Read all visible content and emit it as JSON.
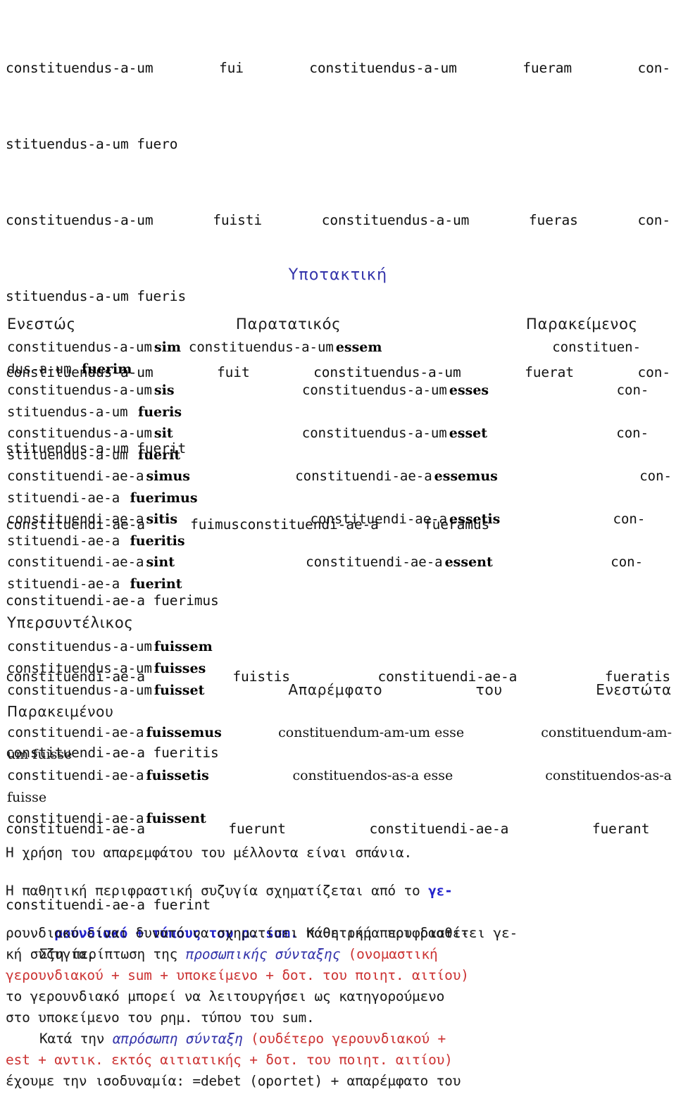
{
  "document": {
    "language": "Greek / Latin grammar reference",
    "indicative_block": {
      "lines": [
        {
          "left_stem": "constituendus-a-um",
          "left_form": "fui",
          "mid_stem": "constituendus-a-um",
          "mid_form": "fueram",
          "tail": "con-"
        },
        {
          "cont": "stituendus-a-um fuero"
        },
        {
          "left_stem": "constituendus-a-um",
          "left_form": "fuisti",
          "mid_stem": "constituendus-a-um",
          "mid_form": "fueras",
          "tail": "con-"
        },
        {
          "cont": "stituendus-a-um fueris"
        },
        {
          "left_stem": "constituendus-a-um",
          "left_form": "fuit",
          "mid_stem": "constituendus-a-um",
          "mid_form": "fuerat",
          "tail": "con-"
        },
        {
          "cont": "stituendus-a-um fuerit"
        },
        {
          "left_stem": "constituendi-ae-a",
          "left_form": "fuimus",
          "mid_stem": "constituendi-ae-a",
          "mid_form": "fueramus",
          "tail": ""
        },
        {
          "cont": "constituendi-ae-a fuerimus"
        },
        {
          "left_stem": "constituendi-ae-a",
          "left_form": "fuistis",
          "mid_stem": "constituendi-ae-a",
          "mid_form": "fueratis",
          "tail": ""
        },
        {
          "cont": "constituendi-ae-a fueritis"
        },
        {
          "left_stem": "constituendi-ae-a",
          "left_form": "fuerunt",
          "mid_stem": "constituendi-ae-a",
          "mid_form": "fuerant",
          "tail": ""
        },
        {
          "cont": "constituendi-ae-a fuerint"
        }
      ]
    },
    "subjunctive": {
      "heading": "Υποτακτική",
      "columns": [
        "Ενεστώς",
        "Παρατατικός",
        "Παρακείμενος"
      ],
      "rows": [
        {
          "c1_stem": "constituendus-a-um",
          "c1_end": "sim",
          "c2_stem": "constituendus-a-um",
          "c2_end": "essem",
          "c3_tail": "constituen-",
          "wrap": "dus-a-um ",
          "wrap_end": "fuerim"
        },
        {
          "c1_stem": "constituendus-a-um",
          "c1_end": "sis",
          "c2_stem": "constituendus-a-um",
          "c2_end": "esses",
          "c3_tail": "con-",
          "wrap": "stituendus-a-um ",
          "wrap_end": "fueris"
        },
        {
          "c1_stem": "constituendus-a-um",
          "c1_end": "sit",
          "c2_stem": "constituendus-a-um",
          "c2_end": "esset",
          "c3_tail": "con-",
          "wrap": "stituendus-a-um ",
          "wrap_end": "fuerit"
        },
        {
          "c1_stem": "constituendi-ae-a",
          "c1_end": "simus",
          "c2_stem": "constituendi-ae-a",
          "c2_end": "essemus",
          "c3_tail": "con-",
          "wrap": "stituendi-ae-a ",
          "wrap_end": "fuerimus"
        },
        {
          "c1_stem": "constituendi-ae-a",
          "c1_end": "sitis",
          "c2_stem": "constituendi-ae-a",
          "c2_end": "essetis",
          "c3_tail": "con-",
          "wrap": "stituendi-ae-a ",
          "wrap_end": "fueritis"
        },
        {
          "c1_stem": "constituendi-ae-a",
          "c1_end": "sint",
          "c2_stem": "constituendi-ae-a",
          "c2_end": "essent",
          "c3_tail": "con-",
          "wrap": "stituendi-ae-a ",
          "wrap_end": "fuerint"
        }
      ]
    },
    "pluperfect": {
      "heading": "Υπερσυντέλικος",
      "rows": [
        {
          "stem": "constituendus-a-um",
          "end": "fuissem"
        },
        {
          "stem": "constituendus-a-um",
          "end": "fuisses"
        },
        {
          "stem": "constituendus-a-um",
          "end": "fuisset",
          "greek1": "Απαρέμφατο",
          "greek2": "του",
          "greek3": "Ενεστώτα"
        },
        {
          "greek_wrap": "Παρακειμένου"
        },
        {
          "stem": "constituendi-ae-a",
          "end": "fuissemus",
          "inf1": "constituendum-am-um esse",
          "inf2": "constituendum-am-"
        },
        {
          "inf_wrap": "um fuisse"
        },
        {
          "stem": "constituendi-ae-a",
          "end": "fuissetis",
          "inf1": "constituendos-as-a esse",
          "inf2": "constituendos-as-a"
        },
        {
          "inf_wrap": "fuisse"
        },
        {
          "stem": "constituendi-ae-a",
          "end": "fuissent"
        }
      ]
    },
    "prose": {
      "note_future_infinitive": "Η χρήση του απαρεμφάτου του μέλλοντα είναι σπάνια.",
      "para_periphrastic": {
        "seg1": "Η παθητική περιφραστική συζυγία σχηματίζεται από το ",
        "seg2_blue_start": "γε-",
        "line2_blue": "ρουνδιακό + τύπους του ρ. sum.",
        "line2_rest": " Κάθε ρήμα που διαθέτει γε-",
        "line3": "ρουνδιακό είναι δυνατό να σχηματίσει παθητική περιφραστι-",
        "line4": "κή συζυγία."
      },
      "para_personal": {
        "lead": "Στη περίπτωση της ",
        "blue_italic": "προσωπικής σύνταξης",
        "red_open": " (ονομαστική",
        "red_line2": "γερουνδιακού + sum + υποκείμενο + δοτ. του ποιητ. αιτίου)",
        "line3": "το γερουνδιακό μπορεί να λειτουργήσει ως κατηγορούμενο",
        "line4": "στο υποκείμενο του ρημ. τύπου του sum."
      },
      "para_impersonal": {
        "lead": "Κατά την ",
        "blue_italic": "απρόσωπη σύνταξη",
        "red_open": " (ουδέτερο γερουνδιακού +",
        "red_line2": "est + αντικ. εκτός αιτιατικής + δοτ. του ποιητ. αιτίου)",
        "line3": "έχουμε την ισοδυναμία: =debet (oportet) + απαρέμφατο του"
      }
    },
    "colors": {
      "heading_blue": "#3333aa",
      "bold_blue": "#2222cc",
      "red": "#cc3333",
      "text_black": "#1a1a1a",
      "background": "#ffffff"
    }
  }
}
